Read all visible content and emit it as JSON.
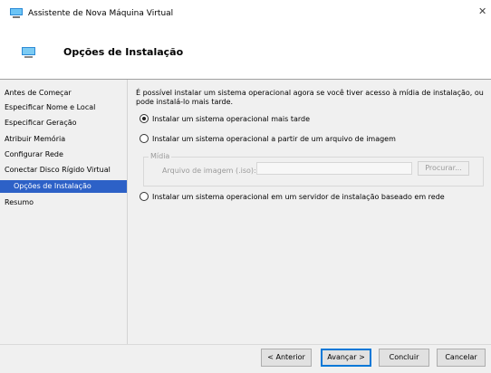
{
  "window": {
    "title": "Assistente de Nova Máquina Virtual",
    "close_glyph": "✕"
  },
  "header": {
    "title": "Opções de Instalação",
    "icon": "monitor-icon"
  },
  "sidebar": {
    "items": [
      {
        "label": "Antes de Começar",
        "selected": false
      },
      {
        "label": "Especificar Nome e Local",
        "selected": false
      },
      {
        "label": "Especificar Geração",
        "selected": false
      },
      {
        "label": "Atribuir Memória",
        "selected": false
      },
      {
        "label": "Configurar Rede",
        "selected": false
      },
      {
        "label": "Conectar Disco Rígido Virtual",
        "selected": false
      },
      {
        "label": "Opções de Instalação",
        "selected": true
      },
      {
        "label": "Resumo",
        "selected": false
      }
    ]
  },
  "main": {
    "intro": "É possível instalar um sistema operacional agora se você tiver acesso à mídia de instalação, ou pode instalá-lo mais tarde.",
    "options": [
      {
        "label": "Instalar um sistema operacional mais tarde",
        "checked": true
      },
      {
        "label": "Instalar um sistema operacional a partir de um arquivo de imagem",
        "checked": false
      },
      {
        "label": "Instalar um sistema operacional em um servidor de instalação baseado em rede",
        "checked": false
      }
    ],
    "media_group": {
      "legend": "Mídia",
      "iso_label": "Arquivo de imagem (.iso):",
      "iso_value": "",
      "browse_label": "Procurar..."
    }
  },
  "footer": {
    "previous": "< Anterior",
    "next": "Avançar >",
    "finish": "Concluir",
    "cancel": "Cancelar"
  },
  "colors": {
    "selection": "#2d61c7",
    "window_bg": "#f0f0f0",
    "default_button_border": "#0078d7"
  }
}
